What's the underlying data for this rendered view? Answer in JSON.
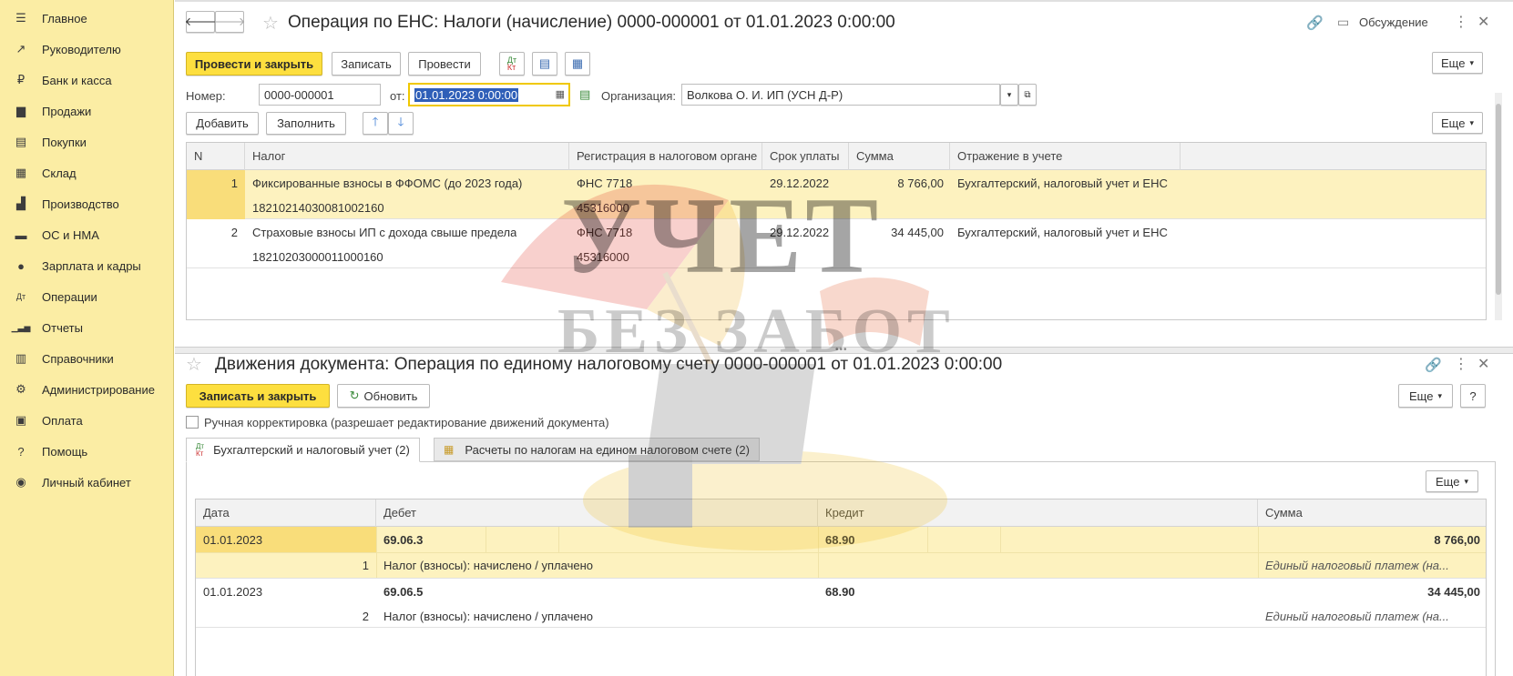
{
  "sidebar": {
    "items": [
      {
        "label": "Главное",
        "icon": "hamburger-icon",
        "glyph": "☰"
      },
      {
        "label": "Руководителю",
        "icon": "trend-icon",
        "glyph": "↗"
      },
      {
        "label": "Банк и касса",
        "icon": "coin-icon",
        "glyph": "₽"
      },
      {
        "label": "Продажи",
        "icon": "bag-icon",
        "glyph": "▆"
      },
      {
        "label": "Покупки",
        "icon": "cart-icon",
        "glyph": "▤"
      },
      {
        "label": "Склад",
        "icon": "warehouse-icon",
        "glyph": "▦"
      },
      {
        "label": "Производство",
        "icon": "factory-icon",
        "glyph": "▟"
      },
      {
        "label": "ОС и НМА",
        "icon": "truck-icon",
        "glyph": "▬"
      },
      {
        "label": "Зарплата и кадры",
        "icon": "person-icon",
        "glyph": "●"
      },
      {
        "label": "Операции",
        "icon": "dt-kt-icon",
        "glyph": "Дт"
      },
      {
        "label": "Отчеты",
        "icon": "bar-chart-icon",
        "glyph": "▁▃▅"
      },
      {
        "label": "Справочники",
        "icon": "books-icon",
        "glyph": "▥"
      },
      {
        "label": "Администрирование",
        "icon": "gear-icon",
        "glyph": "⚙"
      },
      {
        "label": "Оплата",
        "icon": "wallet-icon",
        "glyph": "▣"
      },
      {
        "label": "Помощь",
        "icon": "question-icon",
        "glyph": "?"
      },
      {
        "label": "Личный кабинет",
        "icon": "user-circle-icon",
        "glyph": "◉"
      }
    ]
  },
  "doc": {
    "title": "Операция по ЕНС: Налоги (начисление) 0000-000001 от 01.01.2023 0:00:00",
    "discussion": "Обсуждение",
    "toolbar": {
      "post_close": "Провести и закрыть",
      "save": "Записать",
      "post": "Провести",
      "more": "Еще"
    },
    "number_label": "Номер:",
    "number_value": "0000-000001",
    "date_label": "от:",
    "date_value": "01.01.2023  0:00:00",
    "org_label": "Организация:",
    "org_value": "Волкова О. И. ИП (УСН Д-Р)",
    "table_toolbar": {
      "add": "Добавить",
      "fill": "Заполнить",
      "more": "Еще"
    },
    "columns": [
      "N",
      "Налог",
      "Регистрация в налоговом органе",
      "Срок уплаты",
      "Сумма",
      "Отражение в учете"
    ],
    "rows": [
      {
        "n": "1",
        "tax": "Фиксированные взносы в ФФОМС (до 2023 года)",
        "kbk": "18210214030081002160",
        "reg": "ФНС 7718",
        "oktmo": "45316000",
        "due": "29.12.2022",
        "sum": "8 766,00",
        "reflect": "Бухгалтерский, налоговый учет и ЕНС"
      },
      {
        "n": "2",
        "tax": "Страховые взносы ИП с дохода свыше предела",
        "kbk": "18210203000011000160",
        "reg": "ФНС 7718",
        "oktmo": "45316000",
        "due": "29.12.2022",
        "sum": "34 445,00",
        "reflect": "Бухгалтерский, налоговый учет и ЕНС"
      }
    ]
  },
  "movements": {
    "title": "Движения документа: Операция по единому налоговому счету 0000-000001 от 01.01.2023 0:00:00",
    "save_close": "Записать и закрыть",
    "refresh": "Обновить",
    "more": "Еще",
    "help": "?",
    "manual_label": "Ручная корректировка (разрешает редактирование движений документа)",
    "tabs": [
      {
        "label": "Бухгалтерский и налоговый учет (2)"
      },
      {
        "label": "Расчеты по налогам на едином налоговом счете (2)"
      }
    ],
    "inner_more": "Еще",
    "columns": [
      "Дата",
      "Дебет",
      "Кредит",
      "Сумма"
    ],
    "rows": [
      {
        "date": "01.01.2023",
        "n": "1",
        "debit": "69.06.3",
        "debit_sub": "Налог (взносы): начислено / уплачено",
        "credit": "68.90",
        "sum": "8 766,00",
        "sum_sub": "Единый налоговый платеж (на..."
      },
      {
        "date": "01.01.2023",
        "n": "2",
        "debit": "69.06.5",
        "debit_sub": "Налог (взносы): начислено / уплачено",
        "credit": "68.90",
        "sum": "34 445,00",
        "sum_sub": "Единый налоговый платеж (на..."
      }
    ]
  },
  "watermark": {
    "line1": "УЧЕТ",
    "line2": "БЕЗ ЗАБОТ"
  },
  "colors": {
    "accent_yellow": "#fddf3f",
    "sidebar_bg": "#fbeda4",
    "selection": "#fdf2bf",
    "date_highlight": "#2f5fb8"
  }
}
